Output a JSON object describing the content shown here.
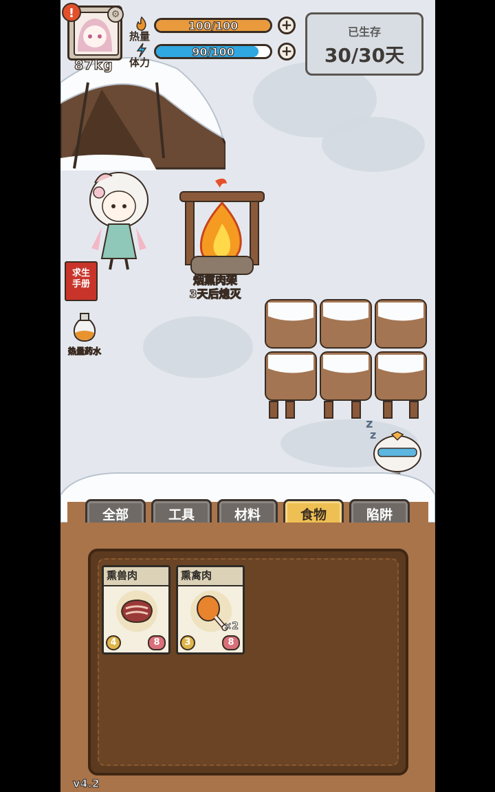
{
  "hud": {
    "weight": "87kg",
    "heat": {
      "label": "热量",
      "value": "100/100",
      "fraction": 1.0,
      "color": "#e89a3c"
    },
    "stamina": {
      "label": "体力",
      "value": "90/100",
      "fraction": 0.9,
      "color": "#2fa7e0"
    },
    "days": {
      "title": "已生存",
      "value": "30/30天"
    }
  },
  "scene": {
    "fire": {
      "name": "烟熏肉架",
      "status": "3天后熄灭"
    },
    "side_buttons": {
      "manual": "求生\n手册",
      "potion": "热量药水"
    },
    "next_day": "下一天"
  },
  "tabs": [
    {
      "label": "全部",
      "active": false
    },
    {
      "label": "工具",
      "active": false
    },
    {
      "label": "材料",
      "active": false
    },
    {
      "label": "食物",
      "active": true
    },
    {
      "label": "陷阱",
      "active": false
    }
  ],
  "items": [
    {
      "name": "熏兽肉",
      "left_badge": "4",
      "right_badge": "8",
      "quantity": "",
      "icon": "smoked-meat-icon"
    },
    {
      "name": "熏禽肉",
      "left_badge": "3",
      "right_badge": "8",
      "quantity": "×2",
      "icon": "drumstick-icon"
    }
  ],
  "version": "v4.2"
}
